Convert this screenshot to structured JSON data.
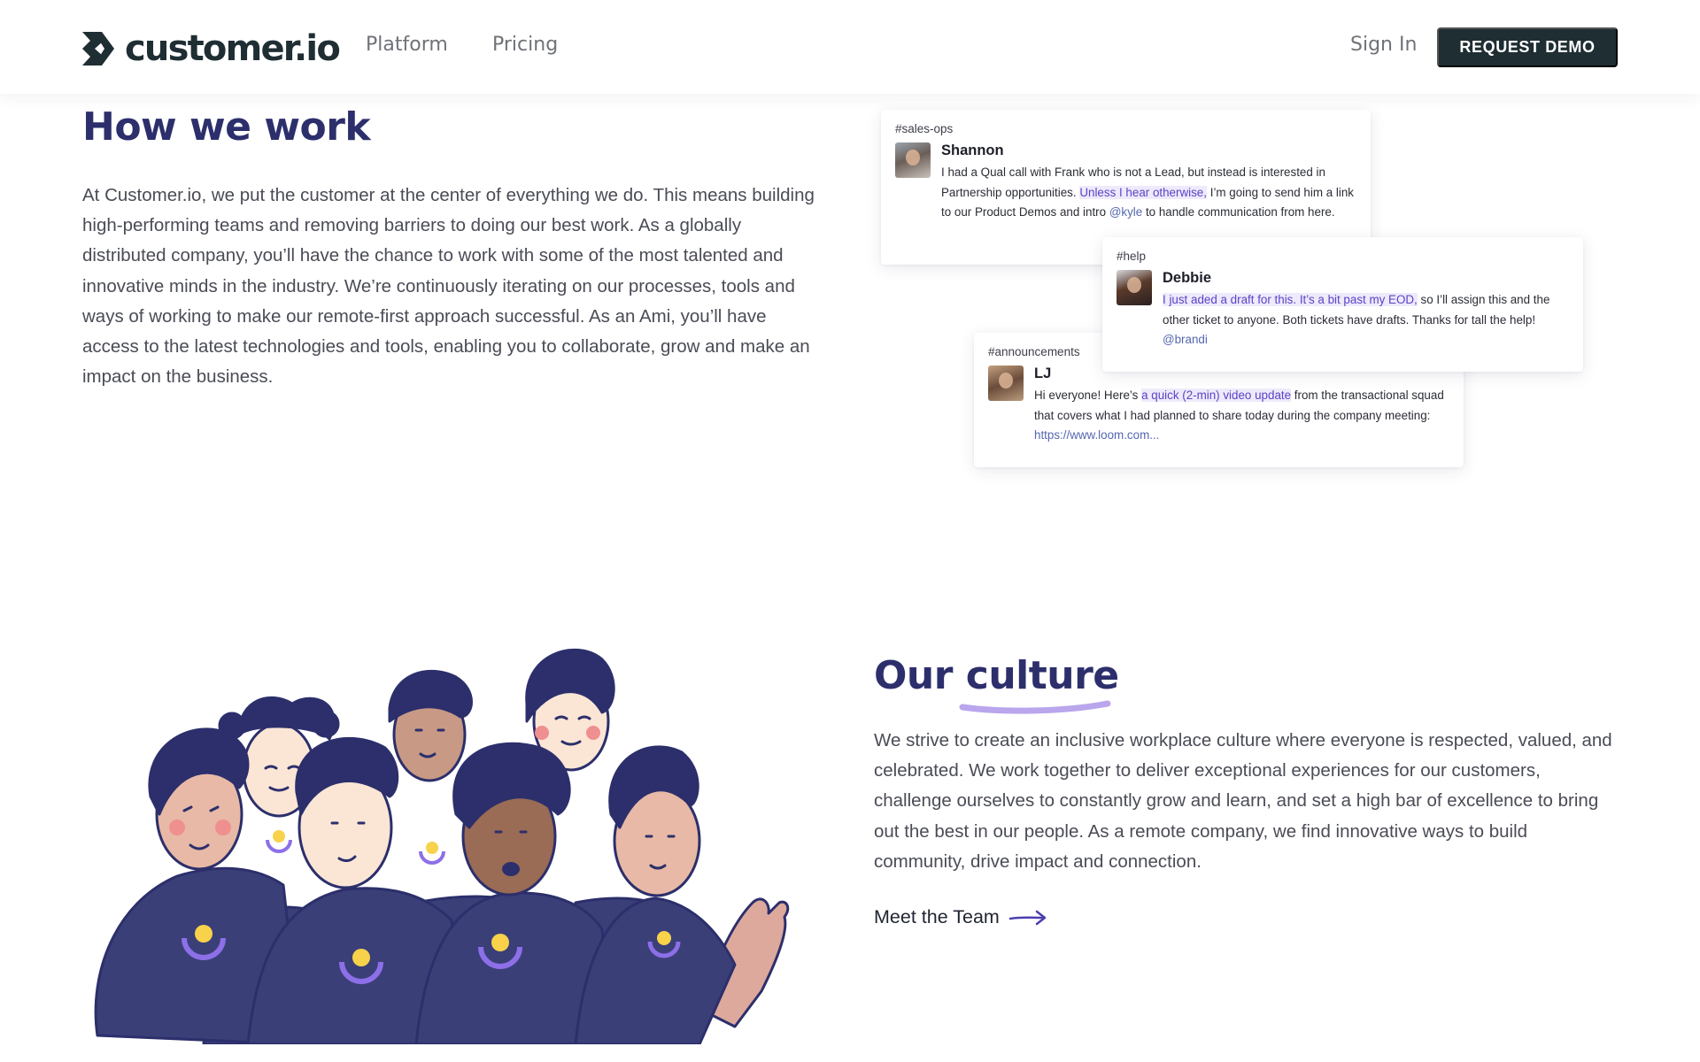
{
  "header": {
    "logo_text": "customer.io",
    "nav": {
      "platform": "Platform",
      "pricing": "Pricing"
    },
    "sign_in": "Sign In",
    "request_demo": "REQUEST DEMO"
  },
  "how_we_work": {
    "title": "How we work",
    "body": "At Customer.io, we put the customer at the center of everything we do. This means building high-performing teams and removing barriers to doing our best work. As a globally distributed company, you’ll have the chance to work with some of the most talented and innovative minds in the industry. We’re continuously iterating on our processes, tools and ways of working to make our remote-first approach successful. As an Ami, you’ll have access to the latest technologies and tools, enabling you to collaborate, grow and make an impact on the business."
  },
  "chat_cards": {
    "shannon": {
      "channel": "#sales-ops",
      "author": "Shannon",
      "text_1": "I had a Qual call with Frank who is not a Lead, but instead is interested in Partnership opportunities.",
      "highlight": "Unless I hear otherwise,",
      "text_2": "I’m going to send him a link to our Product Demos and intro",
      "mention": "@kyle",
      "text_3": "to handle communication from here."
    },
    "debbie": {
      "channel": "#help",
      "author": "Debbie",
      "highlight": "I just aded a draft for this. It’s a bit past my EOD,",
      "text_1": "so I’ll assign this and the other ticket to anyone. Both tickets have drafts. Thanks for tall the help!",
      "mention": "@brandi"
    },
    "lj": {
      "channel": "#announcements",
      "author": "LJ",
      "text_1": "Hi everyone! Here’s",
      "highlight": "a quick (2-min) video update",
      "text_2": "from the transactional squad that covers what I had planned to share today during the company meeting:",
      "link": "https://www.loom.com..."
    }
  },
  "culture": {
    "title_prefix": "Our",
    "title_word": "culture",
    "body": "We strive to create an inclusive workplace culture where everyone is respected, valued, and celebrated. We work together to deliver exceptional experiences for our customers, challenge ourselves to constantly grow and learn, and set a high bar of excellence to bring out the best in our people. As a remote company, we find innovative ways to build community, drive impact and connection.",
    "team_link": "Meet the Team"
  },
  "colors": {
    "navy": "#2c2f6b",
    "dark_button": "#1f2e33",
    "accent_purple": "#5b43c6",
    "underline_lavender": "#b9a6ec",
    "shirt": "#3a3f78"
  }
}
